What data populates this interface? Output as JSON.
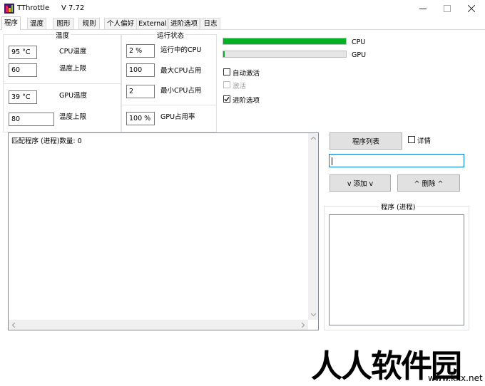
{
  "window": {
    "title": "TThrottle",
    "version": "V 7.72"
  },
  "tabs": [
    "程序",
    "温度",
    "图形",
    "规则",
    "个人偏好",
    "External",
    "进阶选项",
    "日志"
  ],
  "temperature_group": {
    "title": "温度",
    "cpu_temp_value": "95 °C",
    "cpu_temp_label": "CPU温度",
    "cpu_limit_value": "60",
    "cpu_limit_label": "温度上限",
    "gpu_temp_value": "39 °C",
    "gpu_temp_label": "GPU温度",
    "gpu_limit_value": "80",
    "gpu_limit_label": "温度上限"
  },
  "status_group": {
    "title": "运行状态",
    "running_cpu_value": "2 %",
    "running_cpu_label": "运行中的CPU",
    "max_cpu_value": "100",
    "max_cpu_label": "最大CPU占用",
    "min_cpu_value": "2",
    "min_cpu_label": "最小CPU占用",
    "gpu_usage_value": "100 %",
    "gpu_usage_label": "GPU占用率"
  },
  "bars": {
    "cpu_label": "CPU",
    "cpu_fill": 1.0,
    "gpu_label": "GPU",
    "gpu_fill": 0.01,
    "fill_color": "#06b025"
  },
  "options": {
    "auto_activate_label": "自动激活",
    "auto_activate_checked": false,
    "activate_label": "激活",
    "activate_enabled": false,
    "advanced_label": "进阶选项",
    "advanced_checked": true
  },
  "match_panel": {
    "text": "匹配程序 (进程)数量: 0"
  },
  "right_panel": {
    "program_list_button": "程序列表",
    "details_label": "详情",
    "details_checked": false,
    "search_value": "",
    "add_button": "v 添加 v",
    "delete_button": "^ 删除 ^",
    "programs_title": "程序 (进程)"
  },
  "watermark": {
    "text": "人人软件园",
    "url": "www.kkx.net"
  }
}
